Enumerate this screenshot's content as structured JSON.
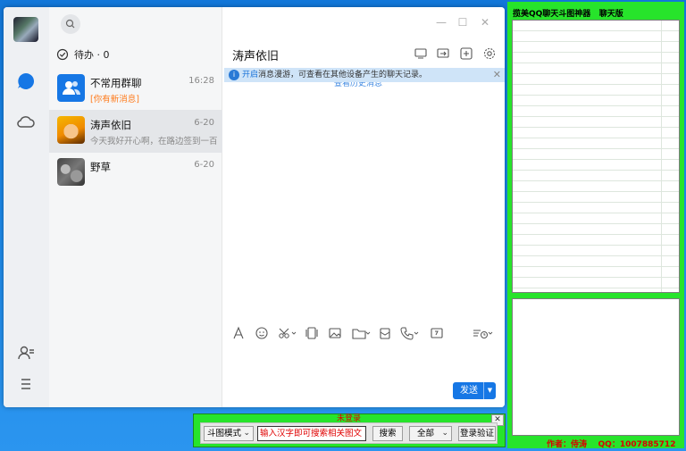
{
  "qq": {
    "todo_label": "待办 · 0",
    "conversations": [
      {
        "name": "不常用群聊",
        "time": "16:28",
        "preview": "[你有新消息]"
      },
      {
        "name": "涛声依旧",
        "time": "6-20",
        "preview": "今天我好开心啊，在路边签到一百块"
      },
      {
        "name": "野草",
        "time": "6-20",
        "preview": ""
      }
    ],
    "chat_title": "涛声依旧",
    "roam_link": "开启",
    "roam_text": "消息漫游，可查看在其他设备产生的聊天记录。",
    "history_link": "查看历史消息",
    "send_label": "发送",
    "send_arrow": "▼"
  },
  "tool": {
    "title": "揽美QQ聊天斗图神器   聊天版",
    "author": "作者：侍涛    QQ：1007885712"
  },
  "searchbar": {
    "status": "未登录",
    "mode": "斗图模式",
    "search_value": "输入汉字即可搜索相关图文",
    "search_button": "搜索",
    "scope": "全部",
    "login_button": "登录验证",
    "close": "✕"
  },
  "colors": {
    "green_panel": "#27e42b",
    "send_blue": "#1677e5",
    "status_red": "#e00000"
  }
}
